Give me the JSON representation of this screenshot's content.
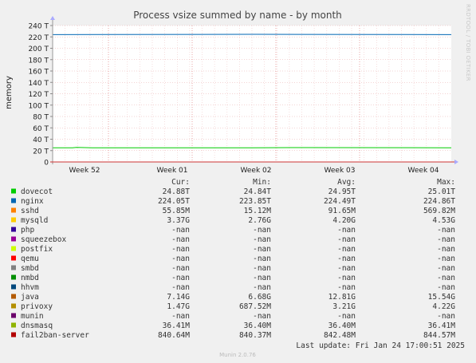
{
  "chart_data": {
    "type": "line",
    "title": "Process vsize summed by name - by month",
    "ylabel": "memory",
    "side_label": "RRDTOOL / TOBI OETIKER",
    "y_unit": "T",
    "ylim": [
      0,
      240
    ],
    "y_ticks": [
      "0",
      "20 T",
      "40 T",
      "60 T",
      "80 T",
      "100 T",
      "120 T",
      "140 T",
      "160 T",
      "180 T",
      "200 T",
      "220 T",
      "240 T"
    ],
    "x_ticks": [
      "Week 52",
      "Week 01",
      "Week 02",
      "Week 03",
      "Week 04"
    ],
    "grid": true,
    "series": [
      {
        "name": "dovecot",
        "color": "#00cc00",
        "x": [
          0,
          0.05,
          0.06,
          0.1,
          0.45,
          0.5,
          0.6,
          0.9,
          0.99,
          1.0
        ],
        "values": [
          24.88,
          24.9,
          25.7,
          24.9,
          24.86,
          24.84,
          25.3,
          25.1,
          25.0,
          24.88
        ]
      },
      {
        "name": "nginx",
        "color": "#0066b3",
        "x": [
          0,
          0.5,
          1.0
        ],
        "values": [
          224.05,
          224.5,
          224.05
        ]
      }
    ],
    "legend": {
      "headers": [
        "Cur:",
        "Min:",
        "Avg:",
        "Max:"
      ],
      "rows": [
        {
          "name": "dovecot",
          "color": "#00cc00",
          "cur": "24.88T",
          "min": "24.84T",
          "avg": "24.95T",
          "max": "25.01T"
        },
        {
          "name": "nginx",
          "color": "#0066b3",
          "cur": "224.05T",
          "min": "223.85T",
          "avg": "224.49T",
          "max": "224.86T"
        },
        {
          "name": "sshd",
          "color": "#ff8000",
          "cur": "55.85M",
          "min": "15.12M",
          "avg": "91.65M",
          "max": "569.82M"
        },
        {
          "name": "mysqld",
          "color": "#ffcc00",
          "cur": "3.37G",
          "min": "2.76G",
          "avg": "4.20G",
          "max": "4.53G"
        },
        {
          "name": "php",
          "color": "#330099",
          "cur": "-nan",
          "min": "-nan",
          "avg": "-nan",
          "max": "-nan"
        },
        {
          "name": "squeezebox",
          "color": "#990099",
          "cur": "-nan",
          "min": "-nan",
          "avg": "-nan",
          "max": "-nan"
        },
        {
          "name": "postfix",
          "color": "#ccff00",
          "cur": "-nan",
          "min": "-nan",
          "avg": "-nan",
          "max": "-nan"
        },
        {
          "name": "qemu",
          "color": "#ff0000",
          "cur": "-nan",
          "min": "-nan",
          "avg": "-nan",
          "max": "-nan"
        },
        {
          "name": "smbd",
          "color": "#808080",
          "cur": "-nan",
          "min": "-nan",
          "avg": "-nan",
          "max": "-nan"
        },
        {
          "name": "nmbd",
          "color": "#008f00",
          "cur": "-nan",
          "min": "-nan",
          "avg": "-nan",
          "max": "-nan"
        },
        {
          "name": "hhvm",
          "color": "#00487d",
          "cur": "-nan",
          "min": "-nan",
          "avg": "-nan",
          "max": "-nan"
        },
        {
          "name": "java",
          "color": "#b35a00",
          "cur": "7.14G",
          "min": "6.68G",
          "avg": "12.81G",
          "max": "15.54G"
        },
        {
          "name": "privoxy",
          "color": "#b38f00",
          "cur": "1.47G",
          "min": "687.52M",
          "avg": "3.21G",
          "max": "4.22G"
        },
        {
          "name": "munin",
          "color": "#6b006b",
          "cur": "-nan",
          "min": "-nan",
          "avg": "-nan",
          "max": "-nan"
        },
        {
          "name": "dnsmasq",
          "color": "#8fb300",
          "cur": "36.41M",
          "min": "36.40M",
          "avg": "36.40M",
          "max": "36.41M"
        },
        {
          "name": "fail2ban-server",
          "color": "#b30000",
          "cur": "840.64M",
          "min": "840.37M",
          "avg": "842.48M",
          "max": "844.57M"
        }
      ]
    },
    "last_update": "Last update: Fri Jan 24 17:00:51 2025",
    "footer": "Munin 2.0.76"
  }
}
